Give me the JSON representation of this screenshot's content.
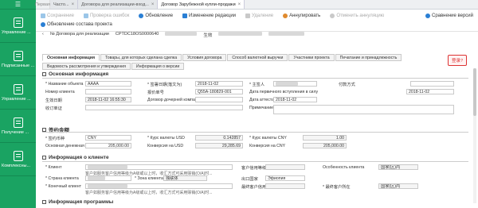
{
  "sidebar": {
    "top_icon": "☰",
    "items": [
      {
        "label": "Управление ...",
        "icon": "document-icon"
      },
      {
        "label": "Подписанные ...",
        "icon": "document-icon"
      },
      {
        "label": "Управление ...",
        "icon": "document-icon"
      },
      {
        "label": "Получение ...",
        "icon": "document-icon"
      },
      {
        "label": "Комплексны...",
        "icon": "document-icon"
      }
    ]
  },
  "tabs": {
    "home": "Первая",
    "items": [
      {
        "label": "Часто...",
        "active": false
      },
      {
        "label": "Договора для реализации-вход...",
        "active": false
      },
      {
        "label": "Договор Зарубежной купли-продажи",
        "active": true
      }
    ],
    "close": "×"
  },
  "toolbar": {
    "row1": [
      {
        "label": "Сохранение",
        "disabled": true,
        "color": "#9bc6e8"
      },
      {
        "label": "Проверка ошибок",
        "disabled": true,
        "color": "#9bc6e8"
      },
      {
        "label": "Обновление",
        "disabled": false,
        "color": "#2a7fd4"
      },
      {
        "label": "Изменение редакции",
        "disabled": false,
        "color": "#2a7fd4"
      },
      {
        "label": "Удаление",
        "disabled": true,
        "color": "#c9c9c9"
      },
      {
        "label": "Аннулировать",
        "disabled": false,
        "color": "#e08a2e"
      },
      {
        "label": "Отменить аннуляцию",
        "disabled": true,
        "color": "#c9c9c9"
      }
    ],
    "compare": "Сравнение версий",
    "row2": {
      "label": "Обновление состава проекта"
    }
  },
  "doc": {
    "prefix": "№ Договора для реализации",
    "number": "CPTDC18OS0000640",
    "status": "生效"
  },
  "subtabs": [
    {
      "label": "Основная информация",
      "active": true
    },
    {
      "label": "Товары, для которых сделана сделка",
      "active": false
    },
    {
      "label": "Условия договора",
      "active": false
    },
    {
      "label": "Способ валютной выручки",
      "active": false
    },
    {
      "label": "Участники проекта",
      "active": false
    },
    {
      "label": "Печатание и принадлежность",
      "active": false
    }
  ],
  "subtabs2": [
    {
      "label": "Ведомость рассмотрения и утверждения",
      "active": false
    },
    {
      "label": "Информация о версии",
      "active": false
    }
  ],
  "badge": "登录?",
  "basic": {
    "title": "Основная информация",
    "object_label": "* Название объекта",
    "object_value": "AAAA",
    "sign_date_label": "* 签署日期(落文为)",
    "sign_date_value": "2018-11-02",
    "principal_label": "* 主签人",
    "payment_label": "付款方式",
    "client_no_label": "Номер клиента",
    "report_no_label": "报价单号",
    "report_no_value": "Q55A-180829-001",
    "receipt_label": "Дата первичного вступления в силу",
    "receipt_value": "2018-11-02",
    "create_label": "生效日期",
    "create_value": "2018-11-02 16:55:30",
    "sub_contract_label": "Договор дочерней компании",
    "attest_label": "Дата аттестации",
    "attest_value": "2018-11-02",
    "recv_label": "收订单证",
    "remark_label": "Примечание"
  },
  "amount": {
    "title": "签约金额",
    "currency_label": "* 签约币种",
    "currency_value": "CNY",
    "rate_usd_label": "* Курс валюты USD",
    "rate_usd_value": "0.142857",
    "rate_cny_label": "* Курс валюты CNY",
    "rate_cny_value": "1.00",
    "base_label": "Основная денежная сумма",
    "base_value": "205,000.00",
    "conv_usd_label": "Конверсия на USD",
    "conv_usd_value": "29,285.69",
    "conv_cny_label": "Конверсия на CNY",
    "conv_cny_value": "205,000.00"
  },
  "client": {
    "title": "Информация о клиенте",
    "client_label": "* Клиент",
    "client_rating_label": "客户信用等级",
    "feature_label": "Особенность клиента",
    "feature_value": "国家(区)内",
    "note1": "客户如服务客户信用等级为A级或以上时，收汇方式可采用赊销(O/A)时...",
    "country_label": "* Страна клиента",
    "zone_label": "* Зона клиента",
    "zone_value": "独联体",
    "export_label": "出口国家",
    "export_value": "Эфиопия",
    "final_label": "* Конечный клиент",
    "final_rating_label": "最终客户信用等级",
    "final_country_label": "* 最终客户所在",
    "final_country_value": "国家(区)内",
    "note2": "客户如服务客户信用等级为A级或以上时，收汇方式可采用赊销(O/A)时..."
  },
  "program": {
    "title": "Информация программы"
  }
}
